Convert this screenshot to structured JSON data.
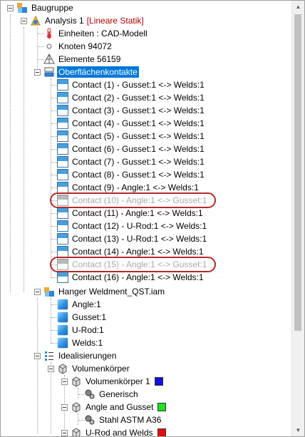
{
  "tree": {
    "root_label": "Baugruppe",
    "analysis": {
      "label": "Analysis 1",
      "type_tag": "[Lineare Statik]"
    },
    "einheiten": "Einheiten : CAD-Modell",
    "knoten": "Knoten 94072",
    "elemente": "Elemente 56159",
    "oberflaechen": "Oberflächenkontakte",
    "contacts": [
      {
        "label": "Contact (1) - Gusset:1 <-> Welds:1",
        "suppressed": false
      },
      {
        "label": "Contact (2) - Gusset:1 <-> Welds:1",
        "suppressed": false
      },
      {
        "label": "Contact (3) - Gusset:1 <-> Welds:1",
        "suppressed": false
      },
      {
        "label": "Contact (4) - Gusset:1 <-> Welds:1",
        "suppressed": false
      },
      {
        "label": "Contact (5) - Gusset:1 <-> Welds:1",
        "suppressed": false
      },
      {
        "label": "Contact (6) - Gusset:1 <-> Welds:1",
        "suppressed": false
      },
      {
        "label": "Contact (7) - Gusset:1 <-> Welds:1",
        "suppressed": false
      },
      {
        "label": "Contact (8) - Gusset:1 <-> Welds:1",
        "suppressed": false
      },
      {
        "label": "Contact (9) - Angle:1 <-> Welds:1",
        "suppressed": false
      },
      {
        "label": "Contact (10) - Angle:1 <-> Gusset:1",
        "suppressed": true
      },
      {
        "label": "Contact (11) - Angle:1 <-> Welds:1",
        "suppressed": false
      },
      {
        "label": "Contact (12) - U-Rod:1 <-> Welds:1",
        "suppressed": false
      },
      {
        "label": "Contact (13) - U-Rod:1 <-> Welds:1",
        "suppressed": false
      },
      {
        "label": "Contact (14) - Angle:1 <-> Welds:1",
        "suppressed": false
      },
      {
        "label": "Contact (15) - Angle:1 <-> Gusset:1",
        "suppressed": true
      },
      {
        "label": "Contact (16) - Angle:1 <-> Welds:1",
        "suppressed": false
      }
    ],
    "assembly": "Hanger Weldment_QST.iam",
    "parts": [
      "Angle:1",
      "Gusset:1",
      "U-Rod:1",
      "Welds:1"
    ],
    "idealisierungen": "Idealisierungen",
    "volumenkoerper": "Volumenkörper",
    "bodies": [
      {
        "label": "Volumenkörper 1",
        "color": "#1010e0",
        "material": "Generisch"
      },
      {
        "label": "Angle and Gusset",
        "color": "#20e020",
        "material": "Stahl ASTM A36"
      },
      {
        "label": "U-Rod and Welds",
        "color": "#e01010",
        "material": ""
      }
    ]
  }
}
